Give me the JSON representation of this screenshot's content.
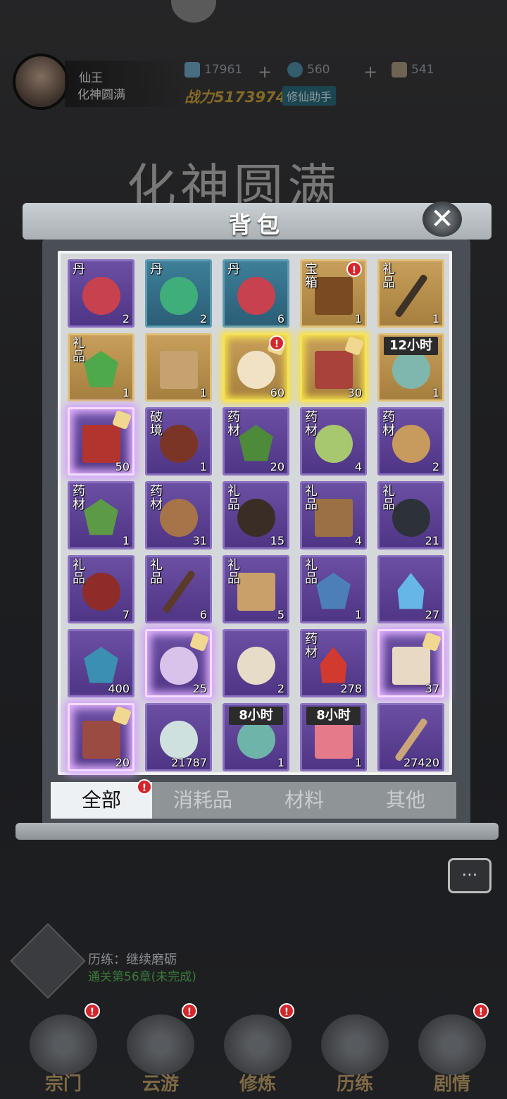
{
  "player": {
    "name": "仙王",
    "realm": "化神圆满"
  },
  "resources": {
    "spirit_stone": "17961",
    "jade": "560",
    "scroll": "541"
  },
  "power": {
    "label": "战力",
    "value": "5173974"
  },
  "helper_label": "修仙助手",
  "realm_banner": "化神圆满",
  "bag": {
    "title": "背包",
    "close_icon": "close-icon",
    "items": [
      {
        "tag": "丹",
        "count": "2",
        "color": "purple",
        "art": "#c8414e",
        "shape": "round"
      },
      {
        "tag": "丹",
        "count": "2",
        "color": "blue",
        "art": "#3fae7a",
        "shape": "round"
      },
      {
        "tag": "丹",
        "count": "6",
        "color": "blue",
        "art": "#c8414e",
        "shape": "round"
      },
      {
        "tag": "宝箱",
        "count": "1",
        "color": "gold",
        "art": "#7a4a22",
        "shape": "box",
        "alert": true
      },
      {
        "tag": "礼品",
        "count": "1",
        "color": "gold",
        "art": "#3d3226",
        "shape": "stick"
      },
      {
        "tag": "礼品",
        "count": "1",
        "color": "gold",
        "art": "#4ea94a",
        "shape": "gem"
      },
      {
        "tag": "",
        "count": "1",
        "color": "gold",
        "art": "#c5a26e",
        "shape": "box"
      },
      {
        "tag": "",
        "count": "60",
        "color": "gold",
        "art": "#f1e2c6",
        "shape": "round",
        "glow": "gold",
        "puzzle": true,
        "alert": true
      },
      {
        "tag": "",
        "count": "30",
        "color": "gold",
        "art": "#a8423a",
        "shape": "box",
        "glow": "gold",
        "puzzle": true
      },
      {
        "tag": "",
        "count": "1",
        "color": "gold",
        "art": "#7fb7ad",
        "shape": "round",
        "time": "12小时"
      },
      {
        "tag": "",
        "count": "50",
        "color": "purple",
        "art": "#b3332e",
        "shape": "box",
        "glow": "purple",
        "puzzle": true
      },
      {
        "tag": "破境",
        "count": "1",
        "color": "purple",
        "art": "#7a3526",
        "shape": "round"
      },
      {
        "tag": "药材",
        "count": "20",
        "color": "purple",
        "art": "#4d8a3a",
        "shape": "gem"
      },
      {
        "tag": "药材",
        "count": "4",
        "color": "purple",
        "art": "#a8c870",
        "shape": "round"
      },
      {
        "tag": "药材",
        "count": "2",
        "color": "purple",
        "art": "#c79a5e",
        "shape": "round"
      },
      {
        "tag": "药材",
        "count": "1",
        "color": "purple",
        "art": "#5c9a45",
        "shape": "gem"
      },
      {
        "tag": "药材",
        "count": "31",
        "color": "purple",
        "art": "#a7744a",
        "shape": "round"
      },
      {
        "tag": "礼品",
        "count": "15",
        "color": "purple",
        "art": "#3a2d25",
        "shape": "round"
      },
      {
        "tag": "礼品",
        "count": "4",
        "color": "purple",
        "art": "#9a7044",
        "shape": "box"
      },
      {
        "tag": "礼品",
        "count": "21",
        "color": "purple",
        "art": "#2c3238",
        "shape": "round"
      },
      {
        "tag": "礼品",
        "count": "7",
        "color": "purple",
        "art": "#8e2c2a",
        "shape": "round"
      },
      {
        "tag": "礼品",
        "count": "6",
        "color": "purple",
        "art": "#5a3a28",
        "shape": "stick"
      },
      {
        "tag": "礼品",
        "count": "5",
        "color": "purple",
        "art": "#caa06a",
        "shape": "box"
      },
      {
        "tag": "礼品",
        "count": "1",
        "color": "purple",
        "art": "#4c7fb8",
        "shape": "gem"
      },
      {
        "tag": "",
        "count": "27",
        "color": "purple",
        "art": "#66b6e8",
        "shape": "flame"
      },
      {
        "tag": "",
        "count": "400",
        "color": "purple",
        "art": "#3b8fb0",
        "shape": "gem"
      },
      {
        "tag": "",
        "count": "25",
        "color": "purple",
        "art": "#d9c3ea",
        "shape": "round",
        "glow": "purple",
        "puzzle": true
      },
      {
        "tag": "",
        "count": "2",
        "color": "purple",
        "art": "#e6dcc8",
        "shape": "round"
      },
      {
        "tag": "药材",
        "count": "278",
        "color": "purple",
        "art": "#d23a2f",
        "shape": "flame"
      },
      {
        "tag": "",
        "count": "37",
        "color": "purple",
        "art": "#e8d9c4",
        "shape": "box",
        "glow": "purple",
        "puzzle": true
      },
      {
        "tag": "",
        "count": "20",
        "color": "purple",
        "art": "#9b4b42",
        "shape": "box",
        "glow": "purple",
        "puzzle": true
      },
      {
        "tag": "",
        "count": "21787",
        "color": "purple",
        "art": "#cfe1de",
        "shape": "round"
      },
      {
        "tag": "",
        "count": "1",
        "color": "purple",
        "art": "#6fb4a8",
        "shape": "round",
        "time": "8小时"
      },
      {
        "tag": "",
        "count": "1",
        "color": "purple",
        "art": "#e57a8a",
        "shape": "box",
        "time": "8小时"
      },
      {
        "tag": "",
        "count": "27420",
        "color": "purple",
        "art": "#caa57a",
        "shape": "stick"
      }
    ],
    "tabs": [
      {
        "label": "全部",
        "active": true,
        "alert": true
      },
      {
        "label": "消耗品"
      },
      {
        "label": "材料"
      },
      {
        "label": "其他"
      }
    ]
  },
  "training": {
    "label": "历练：继续磨砺",
    "status": "通关第56章(未完成)"
  },
  "nav": [
    {
      "label": "宗门",
      "alert": true
    },
    {
      "label": "云游",
      "alert": true
    },
    {
      "label": "修炼",
      "alert": true
    },
    {
      "label": "历练"
    },
    {
      "label": "剧情",
      "alert": true
    }
  ],
  "alert_glyph": "!"
}
